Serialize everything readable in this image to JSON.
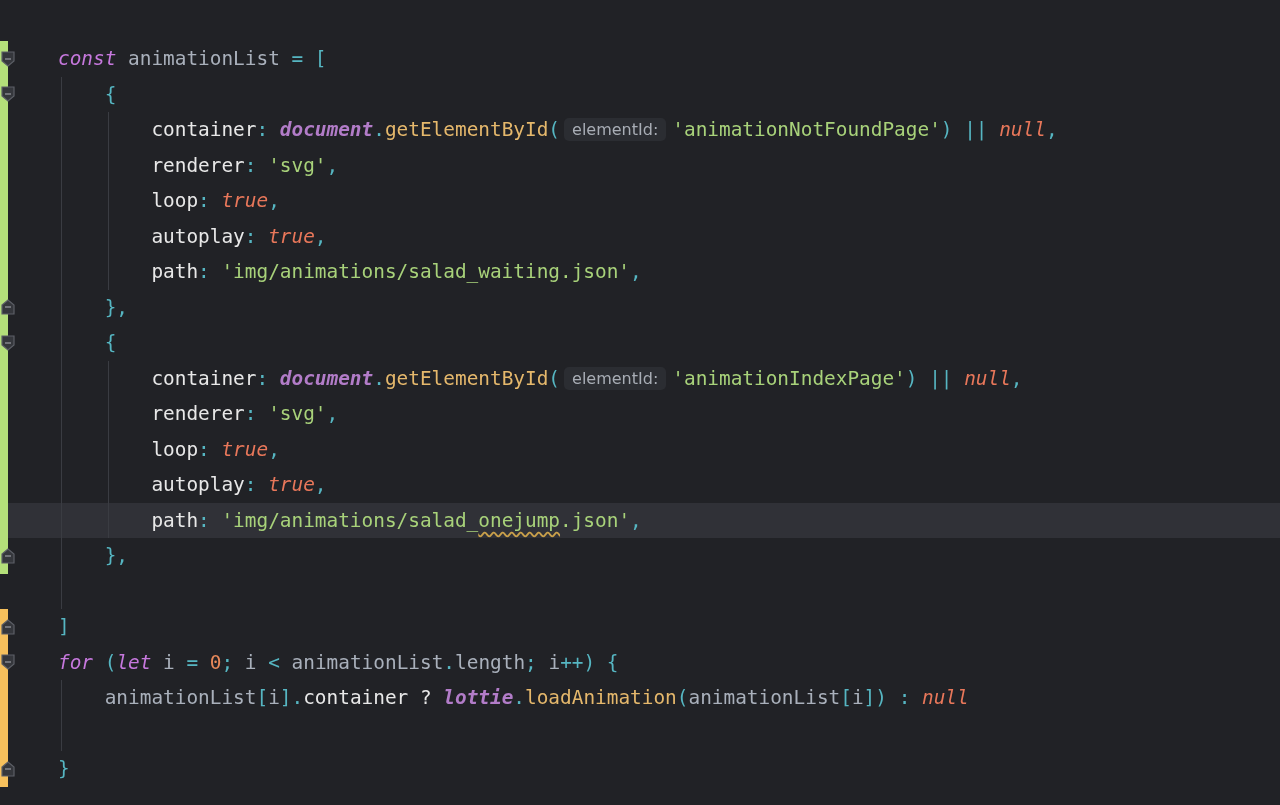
{
  "editor": {
    "lines": [
      {
        "added": true,
        "modified": false,
        "fold_start": true,
        "fold_end": false,
        "current": false,
        "tokens": [
          {
            "kind": "keyword",
            "text": "const"
          },
          {
            "kind": "var",
            "text": " animationList "
          },
          {
            "kind": "punct",
            "text": "= ["
          }
        ],
        "children": [
          {
            "added": true,
            "modified": false,
            "fold_start": true,
            "fold_end": false,
            "current": false,
            "tokens": [
              {
                "kind": "punct",
                "text": "{"
              }
            ],
            "children": [
              {
                "added": true,
                "modified": false,
                "fold_start": false,
                "fold_end": false,
                "current": false,
                "tokens": [
                  {
                    "kind": "prop",
                    "text": "container"
                  },
                  {
                    "kind": "punct",
                    "text": ": "
                  },
                  {
                    "kind": "builtin",
                    "text": "document"
                  },
                  {
                    "kind": "punct",
                    "text": "."
                  },
                  {
                    "kind": "func",
                    "text": "getElementById"
                  },
                  {
                    "kind": "punct",
                    "text": "("
                  },
                  {
                    "kind": "hint",
                    "text": "elementId:"
                  },
                  {
                    "kind": "string",
                    "text": "'animationNotFoundPage'"
                  },
                  {
                    "kind": "punct",
                    "text": ") || "
                  },
                  {
                    "kind": "literal",
                    "text": "null"
                  },
                  {
                    "kind": "punct",
                    "text": ","
                  }
                ]
              },
              {
                "added": true,
                "modified": false,
                "fold_start": false,
                "fold_end": false,
                "current": false,
                "tokens": [
                  {
                    "kind": "prop",
                    "text": "renderer"
                  },
                  {
                    "kind": "punct",
                    "text": ": "
                  },
                  {
                    "kind": "string",
                    "text": "'svg'"
                  },
                  {
                    "kind": "punct",
                    "text": ","
                  }
                ]
              },
              {
                "added": true,
                "modified": false,
                "fold_start": false,
                "fold_end": false,
                "current": false,
                "tokens": [
                  {
                    "kind": "prop",
                    "text": "loop"
                  },
                  {
                    "kind": "punct",
                    "text": ": "
                  },
                  {
                    "kind": "literal",
                    "text": "true"
                  },
                  {
                    "kind": "punct",
                    "text": ","
                  }
                ]
              },
              {
                "added": true,
                "modified": false,
                "fold_start": false,
                "fold_end": false,
                "current": false,
                "tokens": [
                  {
                    "kind": "prop",
                    "text": "autoplay"
                  },
                  {
                    "kind": "punct",
                    "text": ": "
                  },
                  {
                    "kind": "literal",
                    "text": "true"
                  },
                  {
                    "kind": "punct",
                    "text": ","
                  }
                ]
              },
              {
                "added": true,
                "modified": false,
                "fold_start": false,
                "fold_end": false,
                "current": false,
                "tokens": [
                  {
                    "kind": "prop",
                    "text": "path"
                  },
                  {
                    "kind": "punct",
                    "text": ": "
                  },
                  {
                    "kind": "string",
                    "text": "'img/animations/salad_waiting.json'"
                  },
                  {
                    "kind": "punct",
                    "text": ","
                  }
                ]
              }
            ]
          },
          {
            "added": true,
            "modified": false,
            "fold_start": false,
            "fold_end": true,
            "current": false,
            "tokens": [
              {
                "kind": "punct",
                "text": "},"
              }
            ]
          },
          {
            "added": true,
            "modified": false,
            "fold_start": true,
            "fold_end": false,
            "current": false,
            "tokens": [
              {
                "kind": "punct",
                "text": "{"
              }
            ],
            "children": [
              {
                "added": true,
                "modified": false,
                "fold_start": false,
                "fold_end": false,
                "current": false,
                "tokens": [
                  {
                    "kind": "prop",
                    "text": "container"
                  },
                  {
                    "kind": "punct",
                    "text": ": "
                  },
                  {
                    "kind": "builtin",
                    "text": "document"
                  },
                  {
                    "kind": "punct",
                    "text": "."
                  },
                  {
                    "kind": "func",
                    "text": "getElementById"
                  },
                  {
                    "kind": "punct",
                    "text": "("
                  },
                  {
                    "kind": "hint",
                    "text": "elementId:"
                  },
                  {
                    "kind": "string",
                    "text": "'animationIndexPage'"
                  },
                  {
                    "kind": "punct",
                    "text": ") || "
                  },
                  {
                    "kind": "literal",
                    "text": "null"
                  },
                  {
                    "kind": "punct",
                    "text": ","
                  }
                ]
              },
              {
                "added": true,
                "modified": false,
                "fold_start": false,
                "fold_end": false,
                "current": false,
                "tokens": [
                  {
                    "kind": "prop",
                    "text": "renderer"
                  },
                  {
                    "kind": "punct",
                    "text": ": "
                  },
                  {
                    "kind": "string",
                    "text": "'svg'"
                  },
                  {
                    "kind": "punct",
                    "text": ","
                  }
                ]
              },
              {
                "added": true,
                "modified": false,
                "fold_start": false,
                "fold_end": false,
                "current": false,
                "tokens": [
                  {
                    "kind": "prop",
                    "text": "loop"
                  },
                  {
                    "kind": "punct",
                    "text": ": "
                  },
                  {
                    "kind": "literal",
                    "text": "true"
                  },
                  {
                    "kind": "punct",
                    "text": ","
                  }
                ]
              },
              {
                "added": true,
                "modified": false,
                "fold_start": false,
                "fold_end": false,
                "current": false,
                "tokens": [
                  {
                    "kind": "prop",
                    "text": "autoplay"
                  },
                  {
                    "kind": "punct",
                    "text": ": "
                  },
                  {
                    "kind": "literal",
                    "text": "true"
                  },
                  {
                    "kind": "punct",
                    "text": ","
                  }
                ]
              },
              {
                "added": true,
                "modified": false,
                "fold_start": false,
                "fold_end": false,
                "current": true,
                "tokens": [
                  {
                    "kind": "prop",
                    "text": "path"
                  },
                  {
                    "kind": "punct",
                    "text": ": "
                  },
                  {
                    "kind": "string",
                    "text": "'img/animations/salad_"
                  },
                  {
                    "kind": "typo",
                    "text": "onejump"
                  },
                  {
                    "kind": "string",
                    "text": ".json'"
                  },
                  {
                    "kind": "punct",
                    "text": ","
                  }
                ]
              }
            ]
          },
          {
            "added": true,
            "modified": false,
            "fold_start": false,
            "fold_end": true,
            "current": false,
            "tokens": [
              {
                "kind": "punct",
                "text": "},"
              }
            ]
          },
          {
            "added": false,
            "modified": false,
            "fold_start": false,
            "fold_end": false,
            "current": false
          }
        ]
      },
      {
        "added": false,
        "modified": true,
        "fold_start": false,
        "fold_end": true,
        "current": false,
        "tokens": [
          {
            "kind": "punct",
            "text": "]"
          }
        ]
      },
      {
        "added": false,
        "modified": true,
        "fold_start": true,
        "fold_end": false,
        "current": false,
        "tokens": [
          {
            "kind": "keyword",
            "text": "for"
          },
          {
            "kind": "punct",
            "text": " ("
          },
          {
            "kind": "keyword",
            "text": "let"
          },
          {
            "kind": "var",
            "text": " i "
          },
          {
            "kind": "punct",
            "text": "= "
          },
          {
            "kind": "number",
            "text": "0"
          },
          {
            "kind": "punct",
            "text": "; "
          },
          {
            "kind": "var",
            "text": "i "
          },
          {
            "kind": "punct",
            "text": "< "
          },
          {
            "kind": "var",
            "text": "animationList"
          },
          {
            "kind": "punct",
            "text": "."
          },
          {
            "kind": "var",
            "text": "length"
          },
          {
            "kind": "punct",
            "text": "; "
          },
          {
            "kind": "var",
            "text": "i"
          },
          {
            "kind": "punct",
            "text": "++) {"
          }
        ],
        "children": [
          {
            "added": false,
            "modified": true,
            "fold_start": false,
            "fold_end": false,
            "current": false,
            "tokens": [
              {
                "kind": "var",
                "text": "animationList"
              },
              {
                "kind": "punct",
                "text": "["
              },
              {
                "kind": "var",
                "text": "i"
              },
              {
                "kind": "punct",
                "text": "]."
              },
              {
                "kind": "prop",
                "text": "container ? "
              },
              {
                "kind": "builtin",
                "text": "lottie"
              },
              {
                "kind": "punct",
                "text": "."
              },
              {
                "kind": "func",
                "text": "loadAnimation"
              },
              {
                "kind": "punct",
                "text": "("
              },
              {
                "kind": "var",
                "text": "animationList"
              },
              {
                "kind": "punct",
                "text": "["
              },
              {
                "kind": "var",
                "text": "i"
              },
              {
                "kind": "punct",
                "text": "]) : "
              },
              {
                "kind": "literal",
                "text": "null"
              }
            ]
          },
          {
            "added": false,
            "modified": true,
            "fold_start": false,
            "fold_end": false,
            "current": false
          }
        ]
      },
      {
        "added": false,
        "modified": true,
        "fold_start": false,
        "fold_end": true,
        "current": false,
        "tokens": [
          {
            "kind": "punct",
            "text": "}"
          }
        ]
      }
    ]
  }
}
